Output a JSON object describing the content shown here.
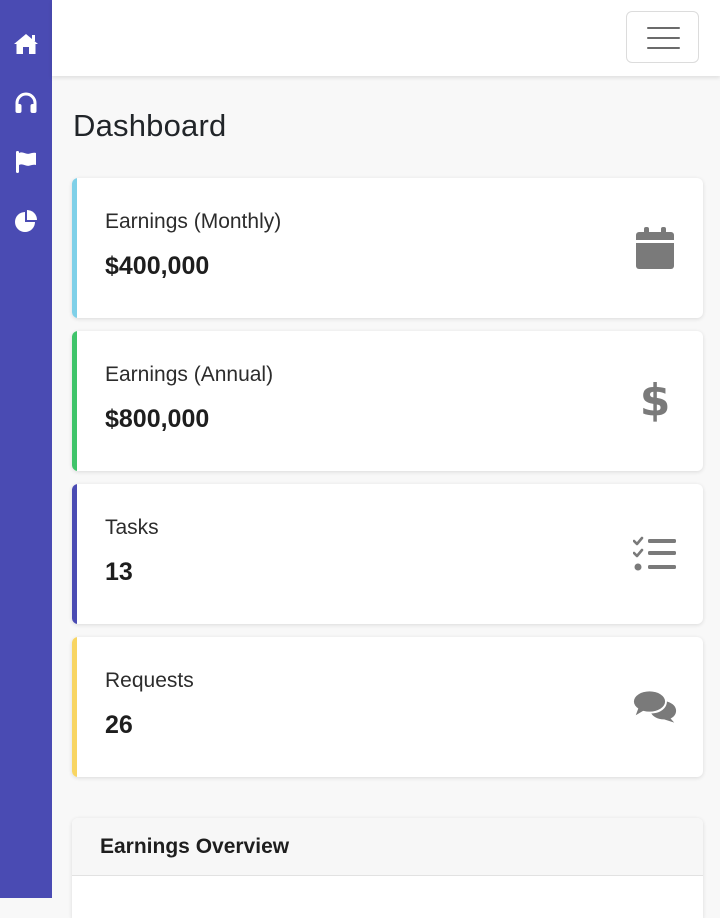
{
  "sidebar": {
    "background": "#4a4bb3",
    "items": [
      {
        "icon": "home-icon"
      },
      {
        "icon": "headphones-icon"
      },
      {
        "icon": "flag-icon"
      },
      {
        "icon": "pie-chart-icon"
      }
    ]
  },
  "topbar": {
    "toggler_icon": "hamburger-menu-icon"
  },
  "page": {
    "title": "Dashboard"
  },
  "cards": [
    {
      "label": "Earnings (Monthly)",
      "value": "$400,000",
      "accent": "#7fd0e8",
      "icon": "calendar-icon"
    },
    {
      "label": "Earnings (Annual)",
      "value": "$800,000",
      "accent": "#3fc46a",
      "icon": "dollar-icon"
    },
    {
      "label": "Tasks",
      "value": "13",
      "accent": "#4a4bb3",
      "icon": "tasks-list-icon"
    },
    {
      "label": "Requests",
      "value": "26",
      "accent": "#f8d562",
      "icon": "comments-icon"
    }
  ],
  "overview": {
    "title": "Earnings Overview"
  },
  "colors": {
    "icon_gray": "#7a7a7a",
    "page_bg": "#f8f8f8"
  }
}
